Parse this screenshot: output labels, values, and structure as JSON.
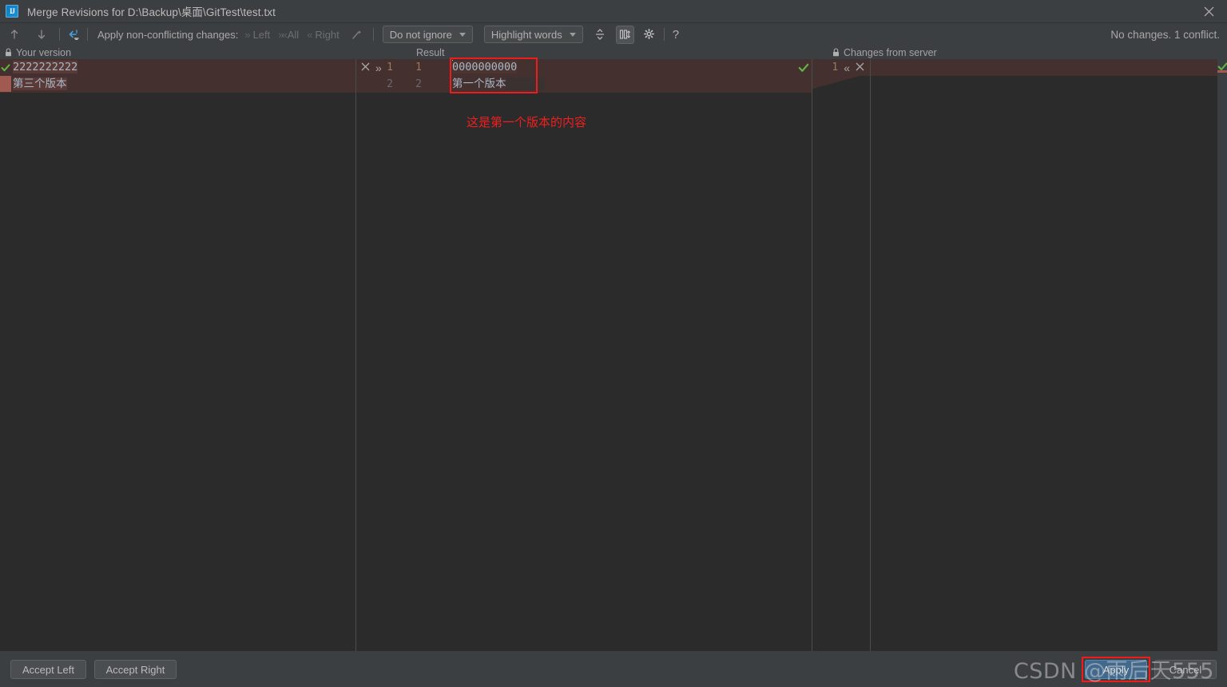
{
  "window": {
    "title": "Merge Revisions for D:\\Backup\\桌面\\GitTest\\test.txt",
    "logo_text": "IJ",
    "close_icon": "close-icon"
  },
  "toolbar": {
    "prev_icon": "arrow-up-icon",
    "next_icon": "arrow-down-icon",
    "apply_all_icon": "apply-all-non-conflicting-icon",
    "apply_label": "Apply non-conflicting changes:",
    "chips": [
      {
        "icon": "chevron-right-double",
        "label": "Left"
      },
      {
        "icon": "chevron-both",
        "label": "All"
      },
      {
        "icon": "chevron-left-double",
        "label": "Right"
      }
    ],
    "magic_icon": "magic-wand-icon",
    "ignore_select": {
      "value": "Do not ignore",
      "caret": "chevron-down-icon"
    },
    "highlight_select": {
      "value": "Highlight words",
      "caret": "chevron-down-icon"
    },
    "collapse_icon": "collapse-unchanged-icon",
    "sync_scroll_icon": "synchronize-scrolling-icon",
    "settings_icon": "gear-icon",
    "help_icon": "?",
    "status": "No changes. 1 conflict."
  },
  "panels": {
    "left": {
      "header": "Your version",
      "lock_icon": "lock-icon",
      "accept_icon": "green-check-icon",
      "lines": [
        {
          "num": "",
          "text": "2222222222",
          "highlighted": true
        },
        {
          "num": "",
          "text": "第三个版本",
          "highlighted": true
        }
      ]
    },
    "result": {
      "header": "Result",
      "left_line_numbers": [
        "1",
        "2"
      ],
      "right_line_numbers": [
        "1",
        "2"
      ],
      "gutter_actions": [
        {
          "icon": "close-x-icon",
          "name": "ignore-change"
        },
        {
          "icon": "chevron-right-double-icon",
          "name": "accept-left-change"
        }
      ],
      "lines": [
        {
          "text": "0000000000"
        },
        {
          "text": "第一个版本"
        }
      ],
      "caret_visible": true,
      "ok_check_icon": "green-check-icon",
      "annotation": "这是第一个版本的内容"
    },
    "right": {
      "header": "Changes from server",
      "lock_icon": "lock-icon",
      "gutter_number": "1",
      "gutter_actions": [
        {
          "icon": "chevron-left-double-icon",
          "name": "accept-right-change"
        },
        {
          "icon": "close-x-icon",
          "name": "ignore-right-change"
        }
      ],
      "lines": [],
      "marker_icon": "green-check-icon"
    }
  },
  "bottom": {
    "accept_left": "Accept Left",
    "accept_right": "Accept Right",
    "apply": "Apply",
    "cancel": "Cancel",
    "watermark": "CSDN @雨后天555"
  },
  "colors": {
    "background": "#3c3f41",
    "editor_background": "#2b2b2b",
    "conflict_band": "#43302f",
    "conflict_marker": "#a05a50",
    "accent_blue": "#41698e",
    "annotation_red": "#f01f1f",
    "check_green": "#62b543",
    "text_primary": "#bbbbbb",
    "code_text": "#a9b7c6",
    "line_number": "#9a7a5a"
  }
}
